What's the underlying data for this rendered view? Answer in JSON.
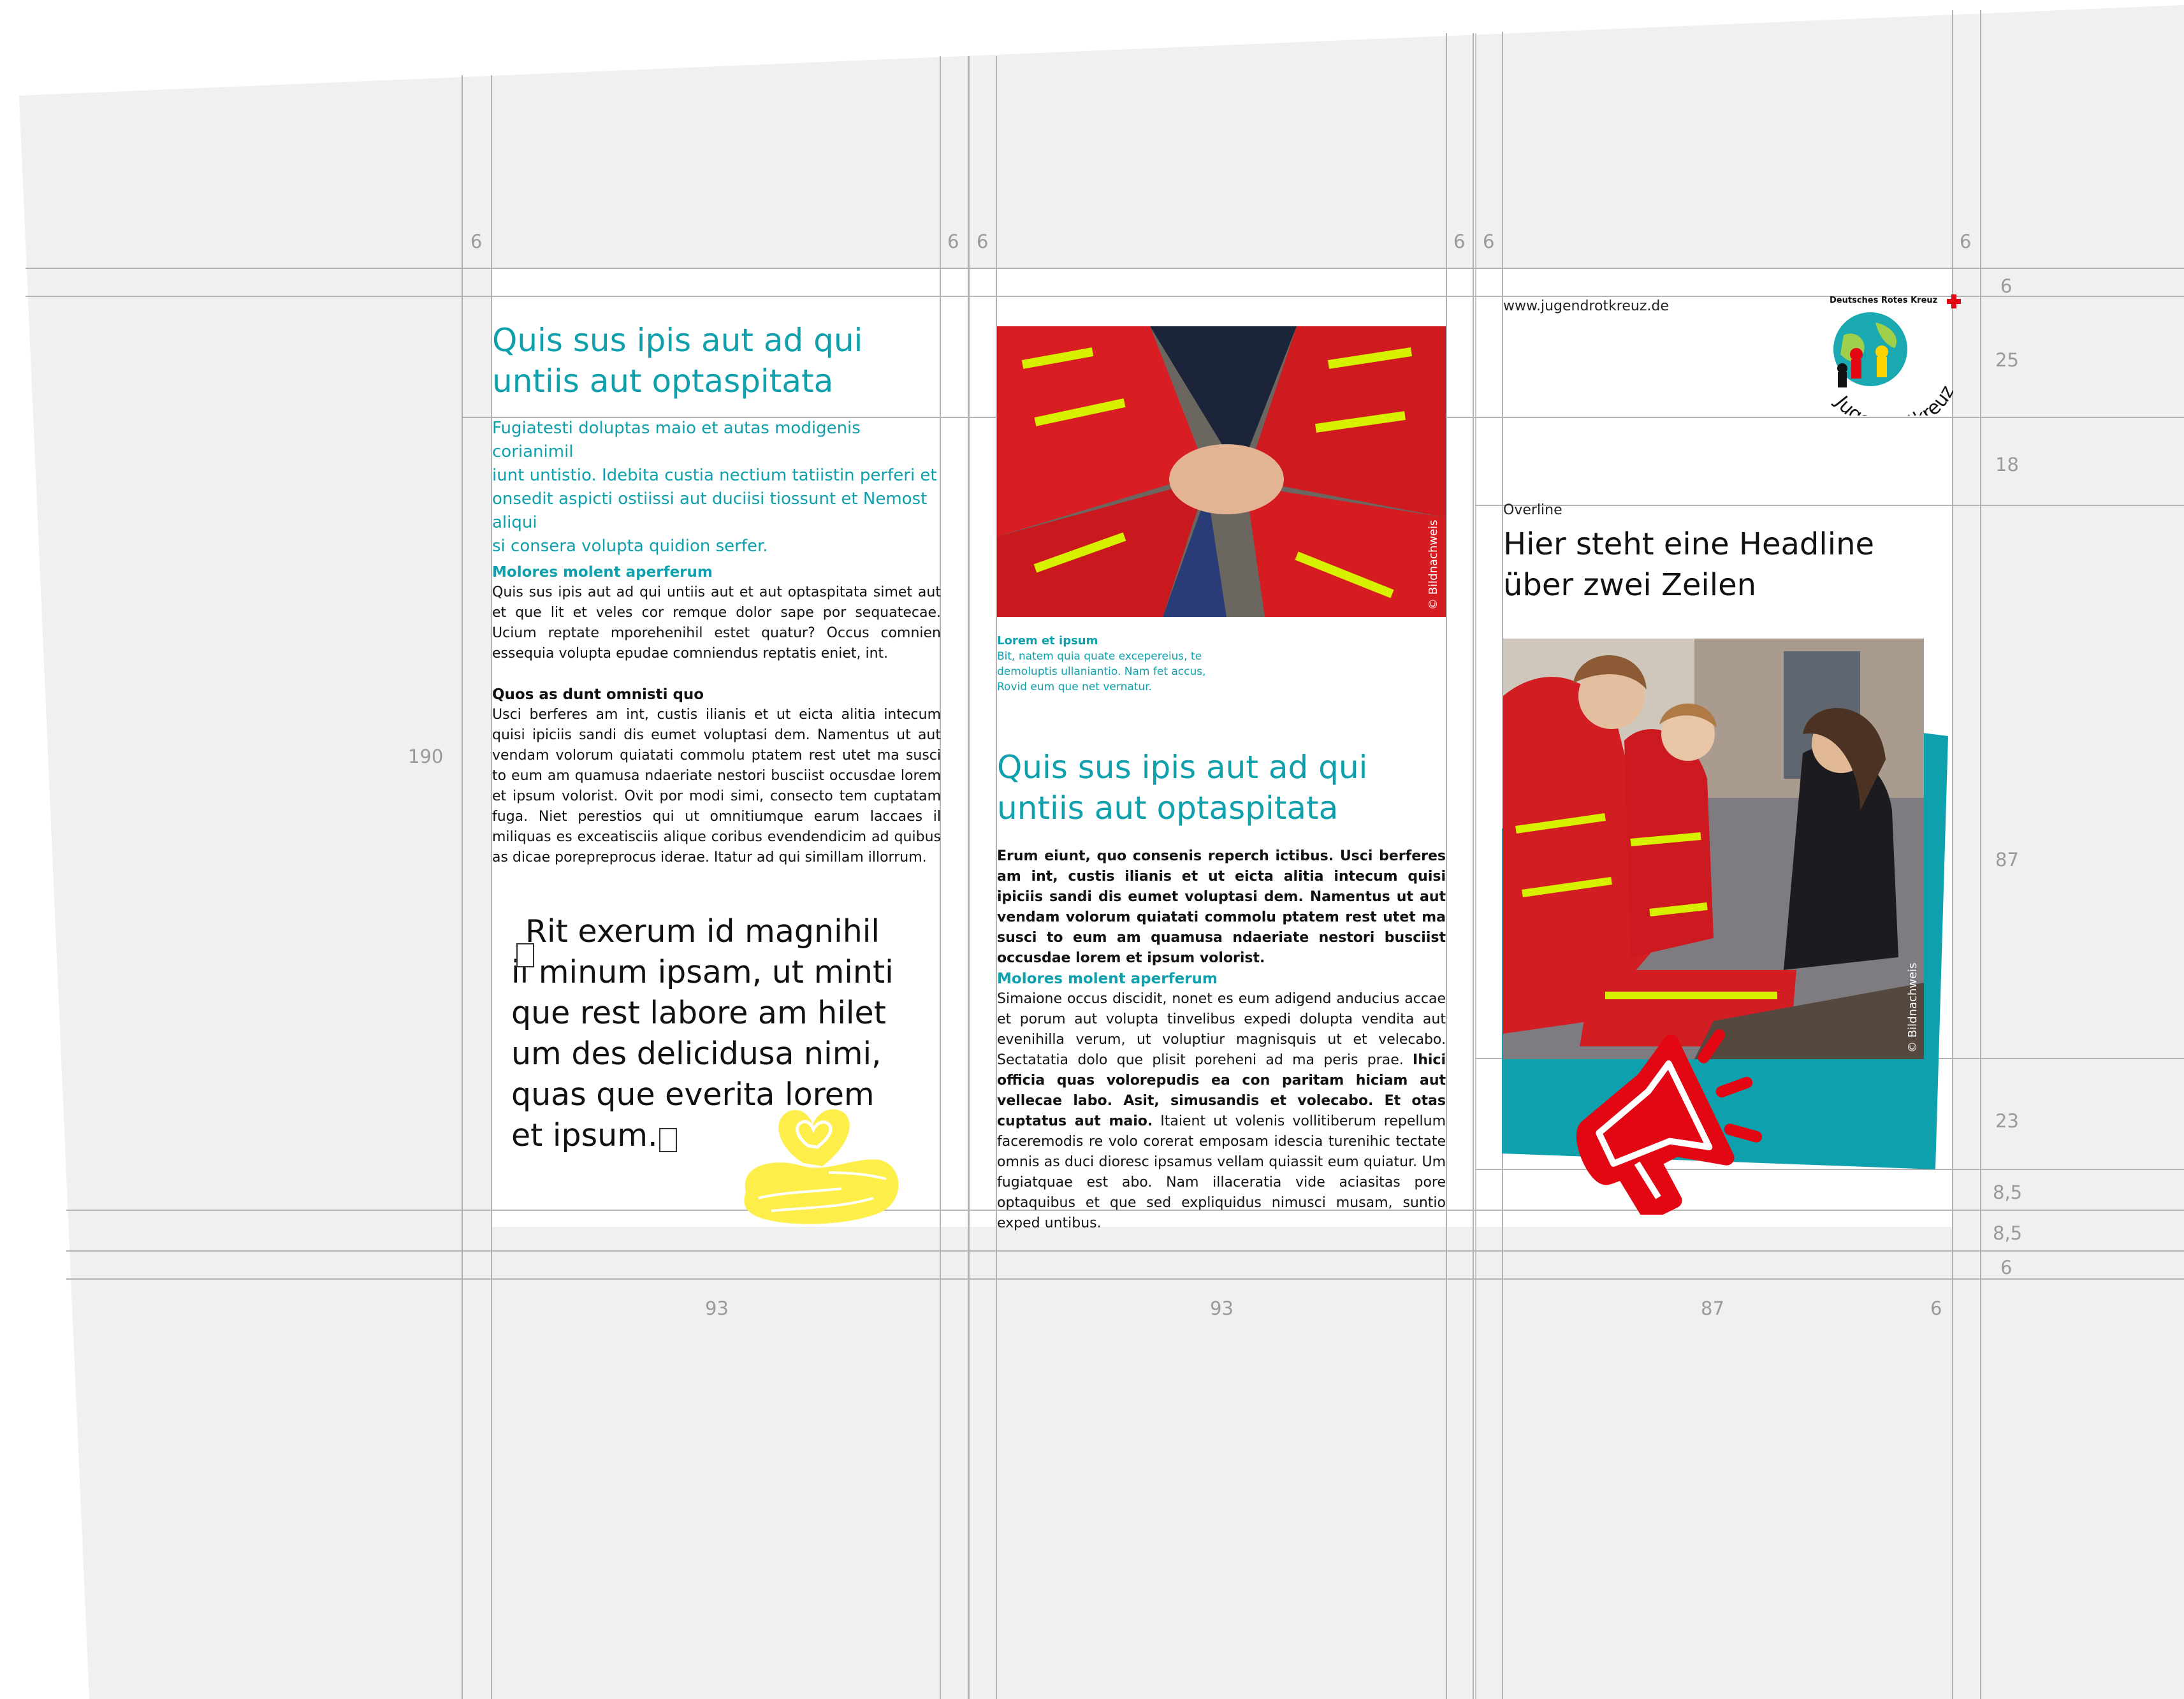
{
  "dimensions": {
    "top_left_gutter": "6",
    "top_mid_gutter_a": "6",
    "top_mid_gutter_b": "6",
    "top_right_gutter_a": "6",
    "top_right_gutter_b": "6",
    "top_far_right": "6",
    "left_height": "190",
    "right_top_margin": "6",
    "right_header": "25",
    "right_gap": "18",
    "right_image": "87",
    "right_band": "23",
    "right_small_a": "8,5",
    "right_small_b": "8,5",
    "right_bottom": "6",
    "col1_width": "93",
    "col2_width": "93",
    "col3_width": "87",
    "col3_gutter": "6"
  },
  "panel1": {
    "headline_line1": "Quis sus ipis aut ad qui",
    "headline_line2": "untiis aut optaspitata",
    "intro": [
      "Fugiatesti doluptas maio et autas modigenis corianimil",
      "iunt untistio. Idebita custia nectium tatiistin perferi et",
      "onsedit aspicti ostiissi aut duciisi tiossunt et Nemost aliqui",
      "si consera volupta quidion serfer."
    ],
    "sub1": "Molores molent aperferum",
    "para1": "Quis sus ipis aut ad qui untiis aut et aut optaspitata simet aut et que lit et veles cor remque dolor sape por sequatecae. Ucium reptate mporehenihil estet quatur? Occus comnien essequia volupta epudae comniendus reptatis eniet, int.",
    "sub2": "Quos as dunt omnisti quo",
    "para2": "Usci berferes am int, custis ilianis et ut eicta alitia intecum quisi ipiciis sandi dis eumet voluptasi dem. Namentus ut aut vendam volorum quiatati commolu ptatem rest utet ma susci to eum am quamusa ndaeriate nestori busciist occusdae lorem et ipsum volorist. Ovit por modi simi, consecto tem cuptatam fuga. Niet perestios qui ut omnitiumque earum laccaes il miliquas es exceatisciis alique coribus evendendicim ad quibus as dicae porepreprocus ideraе. Itatur ad qui simillam illorrum.",
    "quote": [
      "Rit exerum id magnihil",
      "il minum ipsam, ut minti",
      "que rest labore am hilet",
      "um des delicidusa nimi,",
      "quas que everita lorem",
      "et ipsum."
    ]
  },
  "panel2": {
    "photo_credit": "© Bildnachweis",
    "caption_title": "Lorem et ipsum",
    "caption_lines": [
      "Bit, natem quia quate excepereius, te",
      "demoluptis ullaniantio. Nam fet accus,",
      "Rovid eum que net vernatur."
    ],
    "headline_line1": "Quis sus ipis aut ad qui",
    "headline_line2": "untiis aut optaspitata",
    "lead": "Erum eiunt, quo consenis reperch ictibus. Usci berferes am int, custis ilianis et ut eicta alitia intecum quisi ipiciis sandi dis eumet voluptasi dem. Namentus ut aut vendam volorum quiatati commolu ptatem rest utet ma susci to eum am quamusa ndaeriate nestori busciist occusdae lorem et ipsum volorist.",
    "sub": "Molores molent aperferum",
    "para_a": "Simaione occus discidit, nonet es eum adigend anducius accae et porum aut volupta tinvelibus expedi dolupta vendita aut evenihilla verum, ut voluptiur magnisquis ut et velecabo. Sectatatia dolo que plisit porehenі ad ma peris prae.",
    "para_bold": "Ihici officia quas volorepudis ea con paritam hiciam aut vellecae labo. Asit, simusandis et volecabo. Et otas cuptatus aut maio.",
    "para_b": "Itaient ut volenis vollitiberum repellum faceremodis re volo corerat emposam idescia turenihic tectate omnis as duci dioresc ipsamus vellam quiassit eum quiatur. Um fugiatquae est abo. Nam illaceratia vide aciasitas pore optaquibus et que sed expliquidus nimusci musam, suntio exped untibus."
  },
  "panel3": {
    "url": "www.jugendrotkreuz.de",
    "logo_top": "Deutsches Rotes Kreuz",
    "logo_word": "Jugendrotkreuz",
    "overline": "Overline",
    "headline_line1": "Hier steht eine Headline",
    "headline_line2": "über zwei Zeilen",
    "photo_credit": "© Bildnachweis"
  },
  "colors": {
    "teal": "#0ea0ac",
    "red": "#e30613",
    "yellow": "#fdee4a",
    "panel_bg": "#f0f0f0"
  },
  "icons": {
    "heart_hand": "heart-in-hand-icon",
    "megaphone": "megaphone-icon",
    "text_overflow": "text-frame-overflow-icon"
  }
}
